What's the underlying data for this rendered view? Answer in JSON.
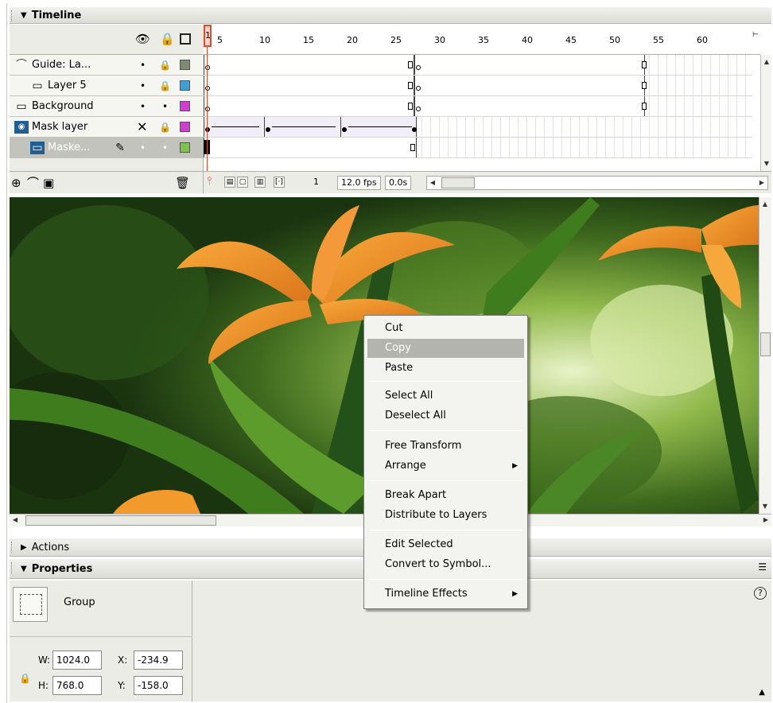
{
  "timeline": {
    "title": "Timeline",
    "header_icons": [
      "eye-icon",
      "lock-icon",
      "outline-icon"
    ],
    "ruler_labels": [
      "1",
      "5",
      "10",
      "15",
      "20",
      "25",
      "30",
      "35",
      "40",
      "45",
      "50",
      "55",
      "60"
    ],
    "layers": [
      {
        "name": "Guide: La...",
        "icon": "guide-layer-icon",
        "visible": "•",
        "lock": "lock-icon",
        "color": "#7e8a72"
      },
      {
        "name": "Layer 5",
        "icon": "layer-icon",
        "visible": "•",
        "lock": "lock-icon",
        "color": "#3aa0d8"
      },
      {
        "name": "Background",
        "icon": "layer-icon",
        "visible": "•",
        "lock": "•",
        "color": "#d33cd3"
      },
      {
        "name": "Mask layer",
        "icon": "mask-layer-icon",
        "visible": "✕",
        "lock": "lock-icon",
        "color": "#d33cd3"
      },
      {
        "name": "Maske...",
        "icon": "masked-layer-icon",
        "visible": "•",
        "lock": "•",
        "color": "#7fc34a"
      }
    ],
    "status": {
      "current_frame": "1",
      "frame_rate": "12.0 fps",
      "elapsed": "0.0s"
    }
  },
  "actions": {
    "title": "Actions"
  },
  "properties": {
    "title": "Properties",
    "selection_type": "Group",
    "w_label": "W:",
    "w_value": "1024.0",
    "h_label": "H:",
    "h_value": "768.0",
    "x_label": "X:",
    "x_value": "-234.9",
    "y_label": "Y:",
    "y_value": "-158.0",
    "help_icon": "?"
  },
  "context_menu": {
    "items": [
      {
        "label": "Cut"
      },
      {
        "label": "Copy"
      },
      {
        "label": "Paste"
      },
      {
        "label": "Select All"
      },
      {
        "label": "Deselect All"
      },
      {
        "label": "Free Transform"
      },
      {
        "label": "Arrange"
      },
      {
        "label": "Break Apart"
      },
      {
        "label": "Distribute to Layers"
      },
      {
        "label": "Edit Selected"
      },
      {
        "label": "Convert to Symbol..."
      },
      {
        "label": "Timeline Effects"
      }
    ],
    "highlighted": "Copy"
  }
}
